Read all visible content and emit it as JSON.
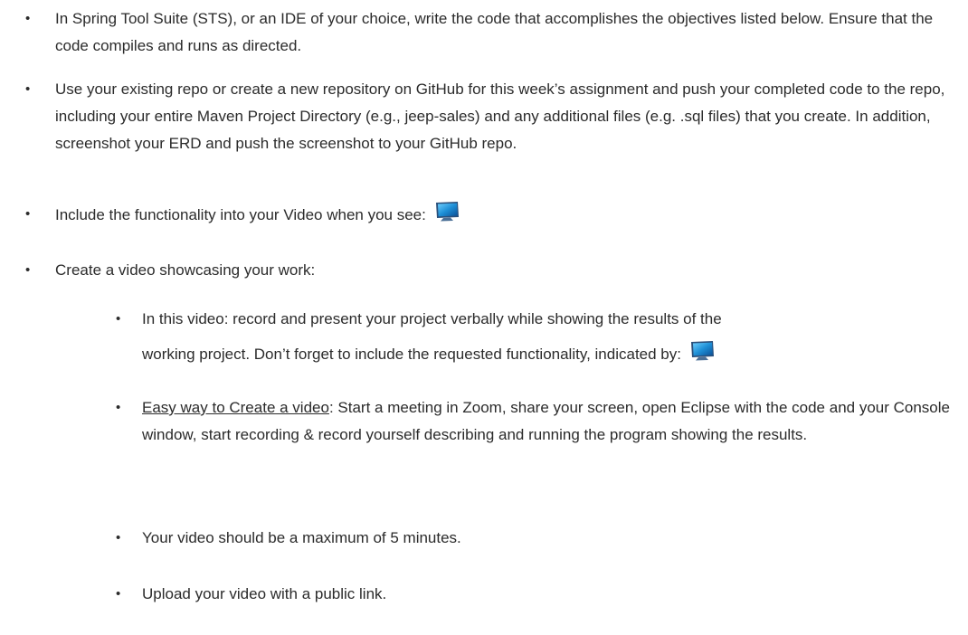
{
  "bullet_glyph": "•",
  "items": [
    {
      "text": "In Spring Tool Suite (STS), or an IDE of your choice, write the code that accomplishes the objectives listed below. Ensure that the code compiles and runs as directed."
    },
    {
      "text": "Use your existing repo or create a new repository on GitHub for this week’s assignment and push your completed code to the repo, including your entire Maven Project Directory (e.g., jeep-sales) and any additional files (e.g. .sql files) that you create.  In addition, screenshot your ERD and push the screenshot to your GitHub repo."
    },
    {
      "text": "Include the functionality into your Video when you see:"
    },
    {
      "text": "Create a video showcasing your work:"
    }
  ],
  "subitems": [
    {
      "line1": "In this video: record and present your project verbally while showing the results of the",
      "line2": "working project.   Don’t forget to include the requested functionality, indicated by:"
    },
    {
      "underlined": "Easy way to Create a video",
      "text": ":  Start a meeting in Zoom, share your screen, open Eclipse with the code and your Console window, start recording & record yourself describing and running the program showing the results."
    },
    {
      "text": "Your video should be a maximum of 5 minutes."
    },
    {
      "text": "Upload your video with a public link."
    }
  ],
  "icons": {
    "video_indicator": "monitor-icon"
  },
  "colors": {
    "text": "#2b2b2b",
    "monitor_screen": "#1e8fd6",
    "monitor_frame": "#2a4f7a"
  }
}
